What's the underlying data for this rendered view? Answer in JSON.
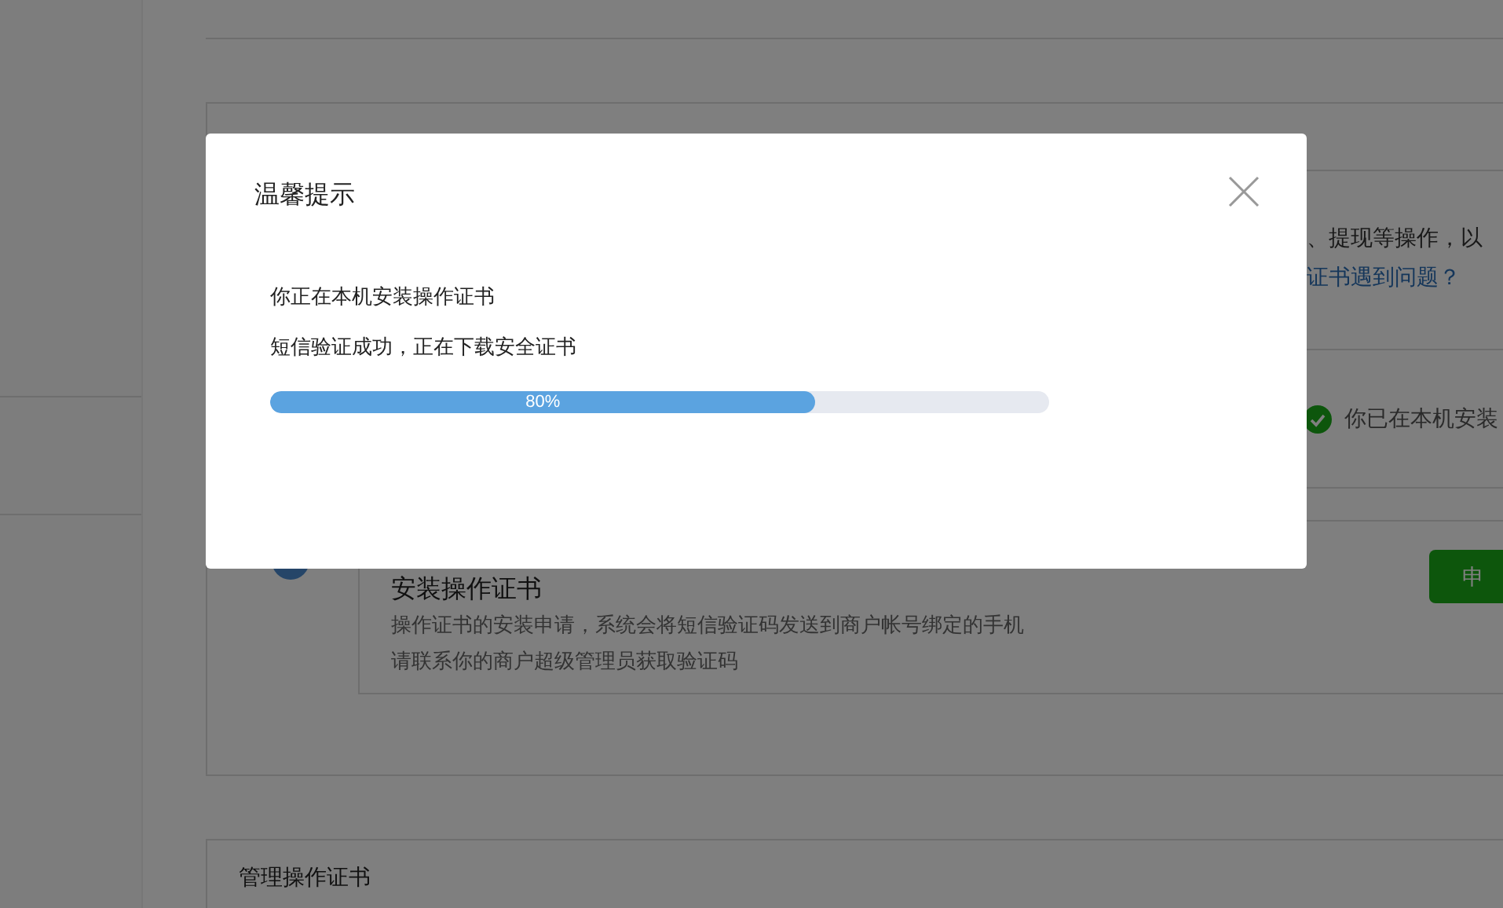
{
  "install_section": {
    "description_fragment": "、提现等操作，以",
    "help_link": "证书遇到问题？",
    "status": "你已在本机安装",
    "step": {
      "title": "安装操作证书",
      "lines": [
        "操作证书的安装申请，系统会将短信验证码发送到商户帐号绑定的手机",
        "请联系你的商户超级管理员获取验证码"
      ],
      "button": "申"
    }
  },
  "manage_section": {
    "title": "管理操作证书"
  },
  "dialog": {
    "title": "温馨提示",
    "lines": [
      "你正在本机安装操作证书",
      "短信验证成功，正在下载安全证书"
    ],
    "progress": {
      "level": 0.7,
      "label": "80%"
    }
  }
}
